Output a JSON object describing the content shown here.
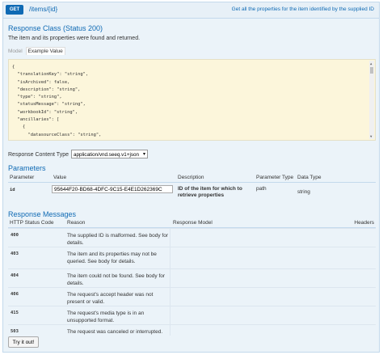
{
  "heading": {
    "method": "GET",
    "path": "/items/{id}",
    "summary": "Get all the properties for the item identified by the supplied ID"
  },
  "response_class": {
    "title": "Response Class (Status 200)",
    "description": "The item and its properties were found and returned.",
    "tab_model": "Model",
    "tab_example": "Example Value",
    "example_lines": [
      "{",
      "  \"translationKey\": \"string\",",
      "  \"isArchived\": false,",
      "  \"description\": \"string\",",
      "  \"type\": \"string\",",
      "  \"statusMessage\": \"string\",",
      "  \"workbookId\": \"string\",",
      "  \"ancillaries\": [",
      "    {",
      "      \"datasourceClass\": \"string\","
    ]
  },
  "content_type": {
    "label": "Response Content Type",
    "selected": "application/vnd.seeq.v1+json"
  },
  "parameters": {
    "title": "Parameters",
    "headers": [
      "Parameter",
      "Value",
      "Description",
      "Parameter Type",
      "Data Type"
    ],
    "rows": [
      {
        "name": "id",
        "value": "95644F20-BD68-4DFC-9C15-E4E1D262369C",
        "description": "ID of the item for which to retrieve properties",
        "param_type": "path",
        "data_type": "string"
      }
    ]
  },
  "response_messages": {
    "title": "Response Messages",
    "headers": [
      "HTTP Status Code",
      "Reason",
      "Response Model",
      "Headers"
    ],
    "rows": [
      {
        "code": "400",
        "reason": "The supplied ID is malformed. See body for details."
      },
      {
        "code": "403",
        "reason": "The item and its properties may not be queried. See body for details."
      },
      {
        "code": "404",
        "reason": "The item could not be found. See body for details."
      },
      {
        "code": "406",
        "reason": "The request's accept header was not present or valid."
      },
      {
        "code": "415",
        "reason": "The request's media type is in an unsupported format."
      },
      {
        "code": "503",
        "reason": "The request was canceled or interrupted."
      }
    ]
  },
  "actions": {
    "try_label": "Try it out!"
  },
  "colors": {
    "accent": "#0f6ab4",
    "panel_bg": "#ebf3f9",
    "code_bg": "#fcf6db"
  }
}
